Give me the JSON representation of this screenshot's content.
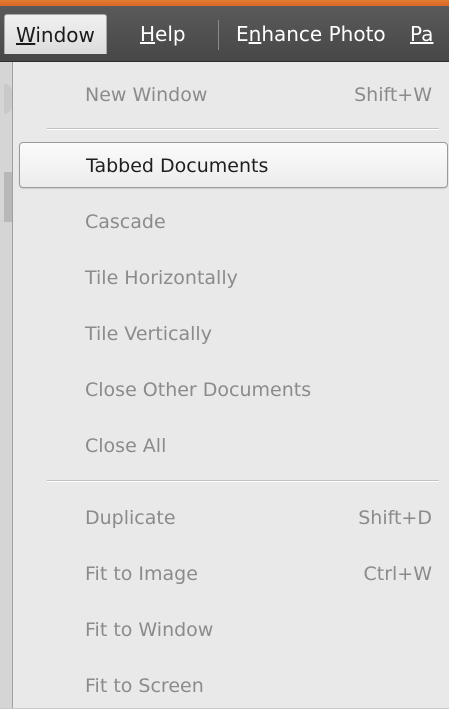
{
  "menubar": {
    "items": [
      {
        "label": "Window",
        "mnemonic": "W",
        "rest": "indow"
      },
      {
        "label": "Help",
        "mnemonic": "H",
        "rest": "elp"
      },
      {
        "label": "Enhance Photo",
        "pre": "E",
        "mnemonic": "n",
        "rest": "hance Photo"
      },
      {
        "label": "Pa"
      }
    ]
  },
  "window_menu": {
    "groups": [
      [
        {
          "label": "New Window",
          "shortcut": "Shift+W",
          "enabled": false
        }
      ],
      [
        {
          "label": "Tabbed Documents",
          "shortcut": "",
          "enabled": true,
          "highlighted": true
        },
        {
          "label": "Cascade",
          "shortcut": "",
          "enabled": false
        },
        {
          "label": "Tile Horizontally",
          "shortcut": "",
          "enabled": false
        },
        {
          "label": "Tile Vertically",
          "shortcut": "",
          "enabled": false
        },
        {
          "label": "Close Other Documents",
          "shortcut": "",
          "enabled": false
        },
        {
          "label": "Close All",
          "shortcut": "",
          "enabled": false
        }
      ],
      [
        {
          "label": "Duplicate",
          "shortcut": "Shift+D",
          "enabled": false
        },
        {
          "label": "Fit to Image",
          "shortcut": "Ctrl+W",
          "enabled": false
        },
        {
          "label": "Fit to Window",
          "shortcut": "",
          "enabled": false
        },
        {
          "label": "Fit to Screen",
          "shortcut": "",
          "enabled": false
        }
      ]
    ]
  },
  "colors": {
    "accent_top": "#e27a2e",
    "menubar_bg": "#4f4f4f",
    "menu_bg": "#e9e9e9",
    "disabled_text": "#8b8b8b",
    "enabled_text": "#1f1f1f"
  }
}
